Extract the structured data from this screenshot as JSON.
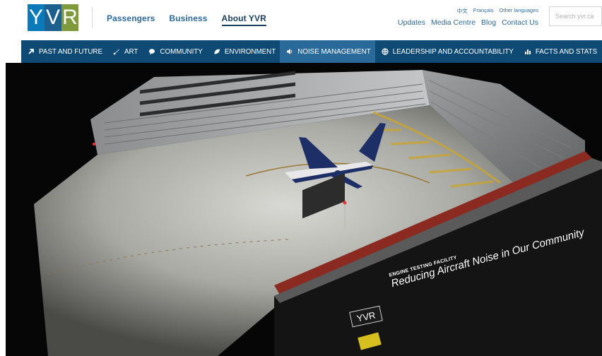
{
  "header": {
    "logo": {
      "letters": [
        "Y",
        "V",
        "R"
      ],
      "colors": [
        "#0a7ab8",
        "#1d5f8f",
        "#7f9a3a"
      ]
    },
    "main_nav": [
      {
        "label": "Passengers",
        "active": false
      },
      {
        "label": "Business",
        "active": false
      },
      {
        "label": "About YVR",
        "active": true
      }
    ],
    "languages": [
      "中文",
      "Français",
      "Other languages"
    ],
    "utility_links": [
      "Updates",
      "Media Centre",
      "Blog",
      "Contact Us"
    ],
    "search": {
      "placeholder": "Search yvr.ca"
    }
  },
  "section_nav": {
    "background": "#0f4a75",
    "active_background": "#2a6a9a",
    "items": [
      {
        "label": "PAST AND FUTURE",
        "icon": "arrow-up-right-icon",
        "active": false
      },
      {
        "label": "ART",
        "icon": "brush-icon",
        "active": false
      },
      {
        "label": "COMMUNITY",
        "icon": "speech-bubble-icon",
        "active": false
      },
      {
        "label": "ENVIRONMENT",
        "icon": "leaf-icon",
        "active": false
      },
      {
        "label": "NOISE MANAGEMENT",
        "icon": "speaker-icon",
        "active": true
      },
      {
        "label": "LEADERSHIP AND ACCOUNTABILITY",
        "icon": "globe-icon",
        "active": false
      },
      {
        "label": "FACTS AND STATS",
        "icon": "bar-chart-icon",
        "active": false
      }
    ]
  },
  "hero": {
    "sign_logo": "YVR",
    "sign_title": "ENGINE TESTING FACILITY",
    "sign_subtitle": "Reducing Aircraft Noise in Our Community"
  }
}
